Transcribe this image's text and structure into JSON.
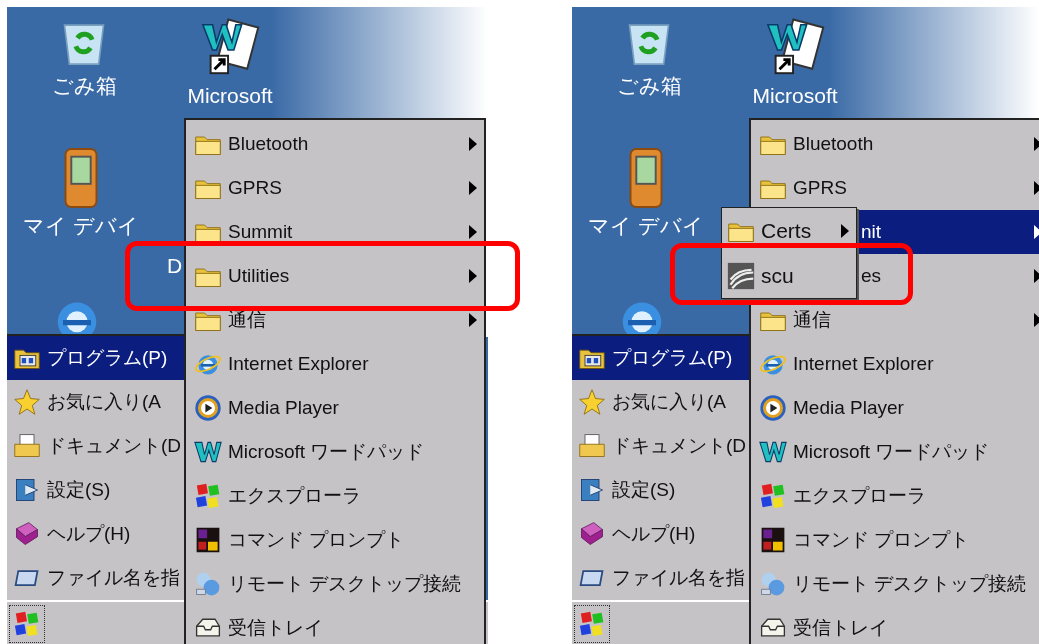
{
  "panels": [
    {
      "desktop_icons": [
        {
          "kind": "recycle",
          "label": "ごみ箱"
        },
        {
          "kind": "wordpad",
          "label": "Microsoft"
        },
        {
          "kind": "device",
          "label": "マイ デバイ"
        },
        {
          "kind": "ie"
        }
      ],
      "desktop_fragments": [
        "D"
      ],
      "start_menu": {
        "items": [
          {
            "kind": "programs",
            "label": "プログラム(P)",
            "selected": true
          },
          {
            "kind": "favorites",
            "label": "お気に入り(A",
            "selected": false
          },
          {
            "kind": "documents",
            "label": "ドキュメント(D",
            "selected": false
          },
          {
            "kind": "settings",
            "label": "設定(S)",
            "selected": false
          },
          {
            "kind": "help",
            "label": "ヘルプ(H)",
            "selected": false
          },
          {
            "kind": "run",
            "label": "ファイル名を指",
            "selected": false
          }
        ]
      },
      "programs": {
        "items": [
          {
            "kind": "folder",
            "label": "Bluetooth",
            "selected": false,
            "highlighted": false
          },
          {
            "kind": "folder",
            "label": "GPRS",
            "selected": false,
            "highlighted": false
          },
          {
            "kind": "folder",
            "label": "Summit",
            "selected": false,
            "highlighted": false
          },
          {
            "kind": "folder",
            "label": "Utilities",
            "selected": false,
            "highlighted": true
          },
          {
            "kind": "folder",
            "label": "通信",
            "selected": false,
            "highlighted": false
          },
          {
            "kind": "browser",
            "label": "Internet Explorer",
            "selected": false,
            "highlighted": false
          },
          {
            "kind": "media",
            "label": "Media Player",
            "selected": false,
            "highlighted": false
          },
          {
            "kind": "editor",
            "label": "Microsoft ワードパッド",
            "selected": false,
            "highlighted": false
          },
          {
            "kind": "explorer",
            "label": "エクスプローラ",
            "selected": false,
            "highlighted": false
          },
          {
            "kind": "console",
            "label": "コマンド プロンプト",
            "selected": false,
            "highlighted": false
          },
          {
            "kind": "remote",
            "label": "リモート デスクトップ接続",
            "selected": false,
            "highlighted": false
          },
          {
            "kind": "mail",
            "label": "受信トレイ",
            "selected": false,
            "highlighted": false
          }
        ]
      }
    },
    {
      "desktop_icons": [
        {
          "kind": "recycle",
          "label": "ごみ箱"
        },
        {
          "kind": "wordpad",
          "label": "Microsoft"
        },
        {
          "kind": "device",
          "label": "マイ デバイ"
        },
        {
          "kind": "ie"
        }
      ],
      "start_menu": {
        "items": [
          {
            "kind": "programs",
            "label": "プログラム(P)",
            "selected": true
          },
          {
            "kind": "favorites",
            "label": "お気に入り(A",
            "selected": false
          },
          {
            "kind": "documents",
            "label": "ドキュメント(D",
            "selected": false
          },
          {
            "kind": "settings",
            "label": "設定(S)",
            "selected": false
          },
          {
            "kind": "help",
            "label": "ヘルプ(H)",
            "selected": false
          },
          {
            "kind": "run",
            "label": "ファイル名を指",
            "selected": false
          }
        ]
      },
      "programs": {
        "items": [
          {
            "kind": "folder",
            "label": "Bluetooth",
            "selected": false,
            "highlighted": false
          },
          {
            "kind": "folder",
            "label": "GPRS",
            "selected": false,
            "highlighted": false
          },
          {
            "kind": "folder",
            "label": "nit",
            "selected": true,
            "highlighted": false
          },
          {
            "kind": "folder",
            "label": "es",
            "selected": false,
            "highlighted": false
          },
          {
            "kind": "folder",
            "label": "通信",
            "selected": false,
            "highlighted": false
          },
          {
            "kind": "browser",
            "label": "Internet Explorer",
            "selected": false,
            "highlighted": false
          },
          {
            "kind": "media",
            "label": "Media Player",
            "selected": false,
            "highlighted": false
          },
          {
            "kind": "editor",
            "label": "Microsoft ワードパッド",
            "selected": false,
            "highlighted": false
          },
          {
            "kind": "explorer",
            "label": "エクスプローラ",
            "selected": false,
            "highlighted": false
          },
          {
            "kind": "console",
            "label": "コマンド プロンプト",
            "selected": false,
            "highlighted": false
          },
          {
            "kind": "remote",
            "label": "リモート デスクトップ接続",
            "selected": false,
            "highlighted": false
          },
          {
            "kind": "mail",
            "label": "受信トレイ",
            "selected": false,
            "highlighted": false
          }
        ]
      },
      "submenu": {
        "items": [
          {
            "kind": "folder",
            "label": "Certs",
            "selected": false,
            "highlighted": false
          },
          {
            "kind": "signal",
            "label": "scu",
            "selected": false,
            "highlighted": true
          }
        ]
      }
    }
  ]
}
